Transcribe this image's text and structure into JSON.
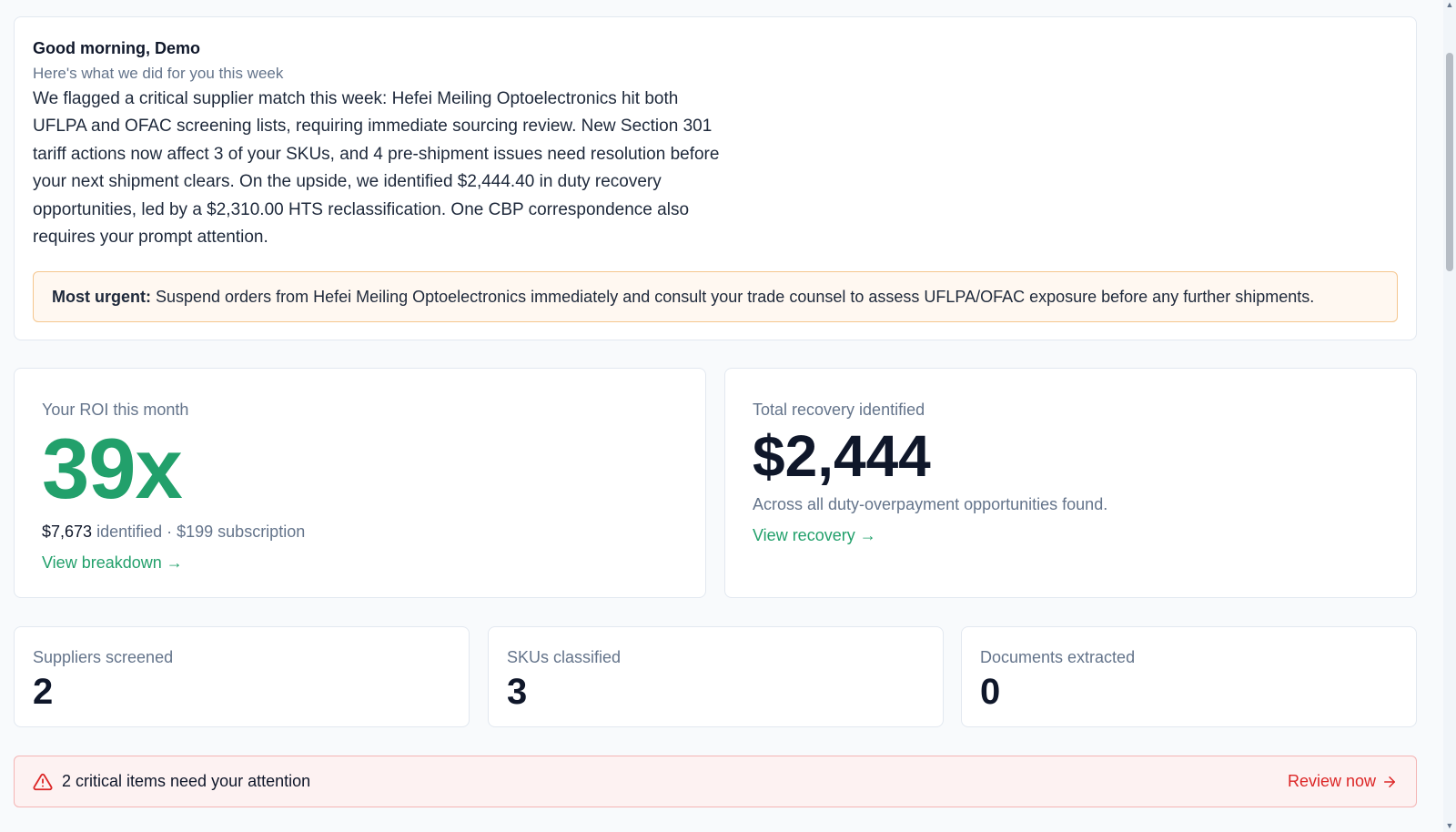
{
  "summary": {
    "greeting": "Good morning, Demo",
    "subtitle": "Here's what we did for you this week",
    "narrative": "We flagged a critical supplier match this week: Hefei Meiling Optoelectronics hit both UFLPA and OFAC screening lists, requiring immediate sourcing review. New Section 301 tariff actions now affect 3 of your SKUs, and 4 pre-shipment issues need resolution before your next shipment clears. On the upside, we identified $2,444.40 in duty recovery opportunities, led by a $2,310.00 HTS reclassification. One CBP correspondence also requires your prompt attention.",
    "urgent_label": "Most urgent:",
    "urgent_text": "Suspend orders from Hefei Meiling Optoelectronics immediately and consult your trade counsel to assess UFLPA/OFAC exposure before any further shipments."
  },
  "roi": {
    "label": "Your ROI this month",
    "value": "39x",
    "identified_amount": "$7,673",
    "identified_suffix": "identified · $199 subscription",
    "link": "View breakdown →"
  },
  "recovery": {
    "label": "Total recovery identified",
    "value": "$2,444",
    "description": "Across all duty-overpayment opportunities found.",
    "link": "View recovery →"
  },
  "stats": [
    {
      "label": "Suppliers screened",
      "value": "2"
    },
    {
      "label": "SKUs classified",
      "value": "3"
    },
    {
      "label": "Documents extracted",
      "value": "0"
    }
  ],
  "alert": {
    "icon": "warning-triangle-icon",
    "text": "2 critical items need your attention",
    "link": "Review now",
    "link_icon": "arrow-right-icon"
  },
  "colors": {
    "accent_green": "#22a06b",
    "alert_red": "#dc2626",
    "urgent_bg": "#fff8f1",
    "urgent_border": "#f5c68e",
    "alert_bg": "#fdf2f2"
  }
}
